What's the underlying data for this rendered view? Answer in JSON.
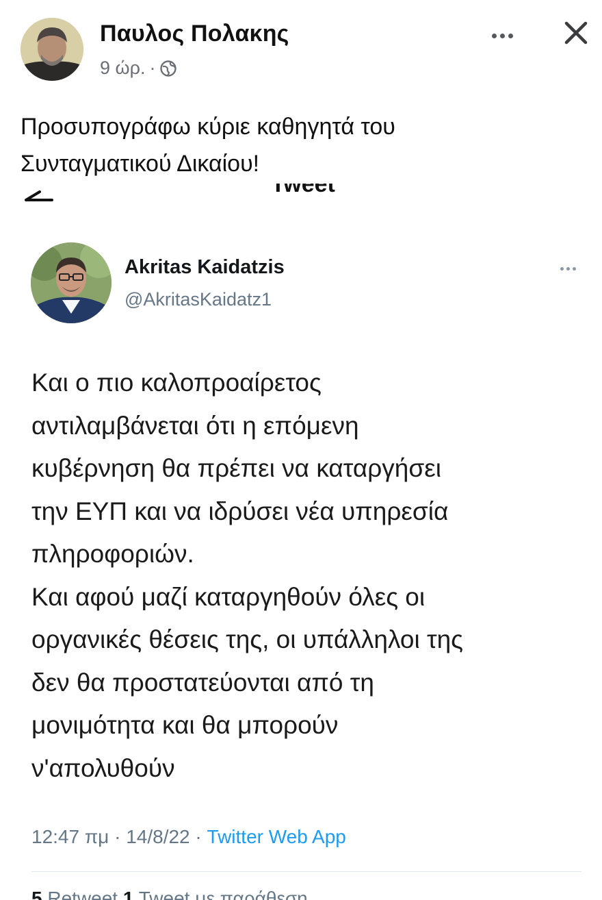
{
  "post": {
    "author": "Παυλος Πολακης",
    "time": "9 ώρ.",
    "separator": "·",
    "text": "Προσυπογράφω κύριε καθηγητά του\nΣυνταγματικού Δικαίου!"
  },
  "tweet": {
    "header_title": "Tweet",
    "author_name": "Akritas Kaidatzis",
    "author_handle": "@AkritasKaidatz1",
    "body": "Και ο πιο καλοπροαίρετος\nαντιλαμβάνεται ότι η επόμενη\nκυβέρνηση θα πρέπει να καταργήσει\nτην ΕΥΠ και να ιδρύσει νέα υπηρεσία\nπληροφοριών.\nΚαι αφού μαζί καταργηθούν όλες οι\nοργανικές θέσεις της, οι υπάλληλοι της\nδεν θα προστατεύονται από τη\nμονιμότητα και θα μπορούν\nν'απολυθούν",
    "time": "12:47 πμ",
    "date": "14/8/22",
    "sep": "·",
    "source": "Twitter Web App",
    "retweets_count": "5",
    "retweets_label": "Retweet",
    "quotes_count": "1",
    "quotes_label": "Tweet με παράθεση"
  },
  "icons": {
    "more_post": "more-horizontal-icon",
    "close": "close-icon",
    "globe": "globe-icon",
    "back": "back-arrow-icon",
    "more_tweet": "more-horizontal-icon"
  },
  "colors": {
    "link": "#1d9bf0",
    "muted": "#657786",
    "fb_muted": "#6b6f75"
  }
}
